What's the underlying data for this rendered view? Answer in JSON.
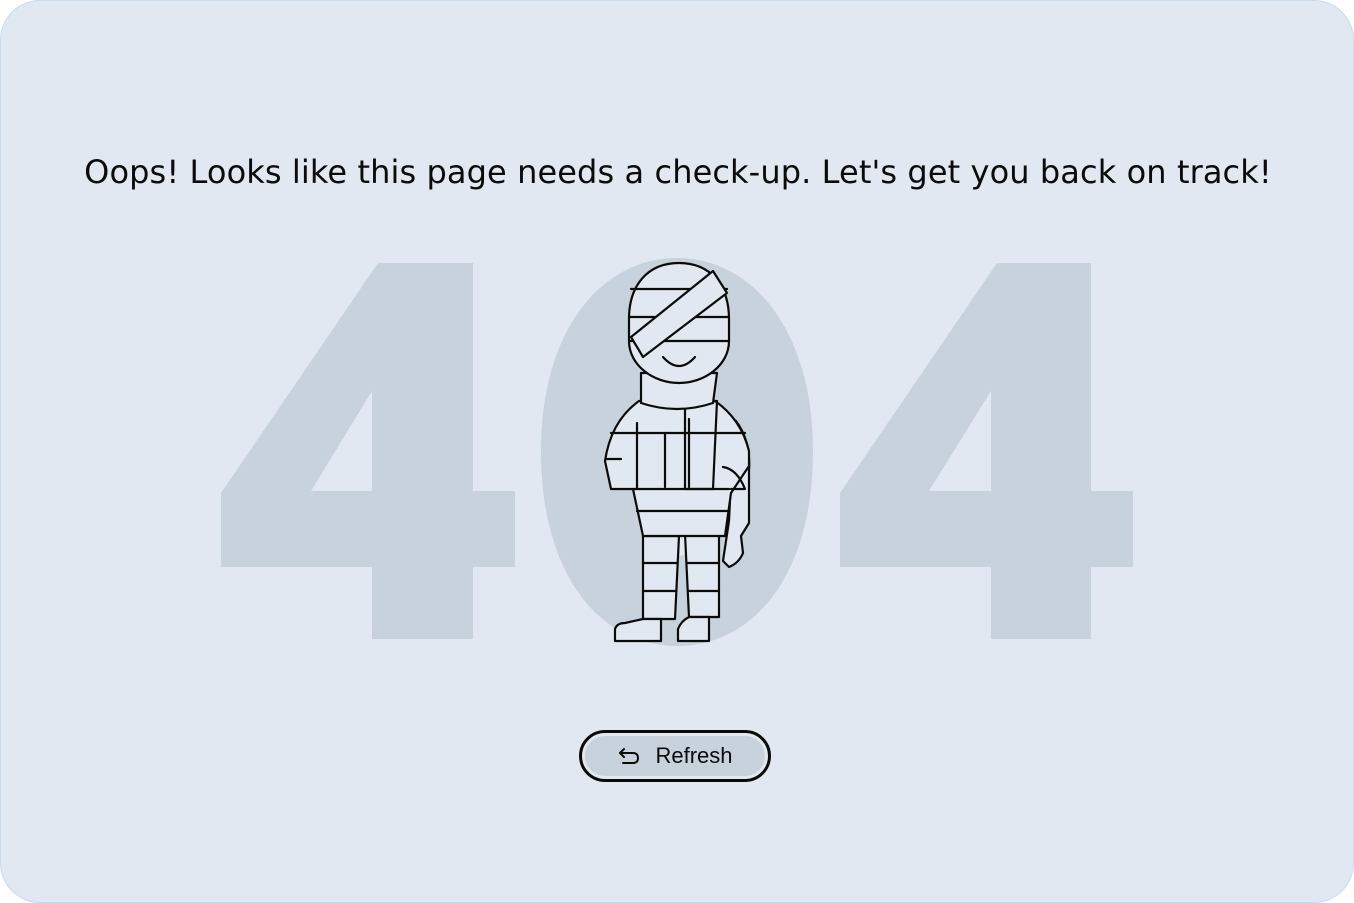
{
  "page": {
    "headline": "Oops! Looks like this page needs a check-up. Let's get you back on track!",
    "error_code": "404",
    "refresh_label": "Refresh",
    "refresh_icon": "return-arrow-icon",
    "illustration": "bandaged-figure-illustration"
  },
  "colors": {
    "background": "#e1e8f1",
    "digits": "#c7d2dc",
    "ink": "#0b0b0b",
    "button_fill": "#c7d2dc"
  }
}
